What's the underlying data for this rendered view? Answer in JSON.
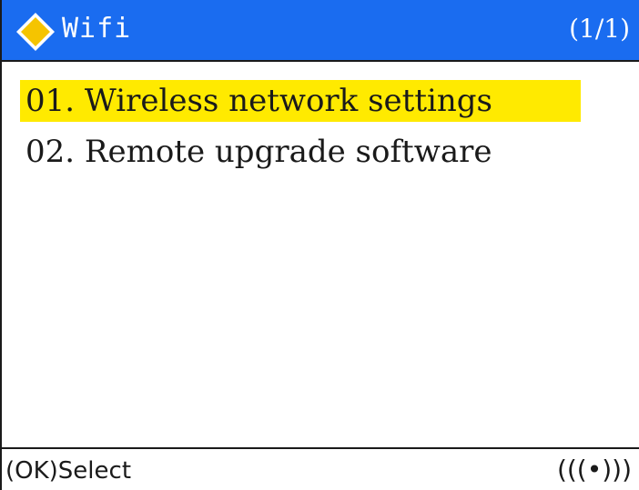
{
  "header": {
    "title": "Wifi",
    "page_indicator": "(1/1)",
    "logo_icon": "yellow-diamond-icon",
    "background_color": "#1a6cf0"
  },
  "menu": {
    "items": [
      {
        "label": "01. Wireless network settings",
        "selected": true
      },
      {
        "label": "02. Remote upgrade software",
        "selected": false
      }
    ],
    "highlight_color": "#ffea00"
  },
  "footer": {
    "hint": "(OK)Select",
    "signal_label": "(((•)))",
    "signal_icon": "wireless-signal-icon"
  }
}
